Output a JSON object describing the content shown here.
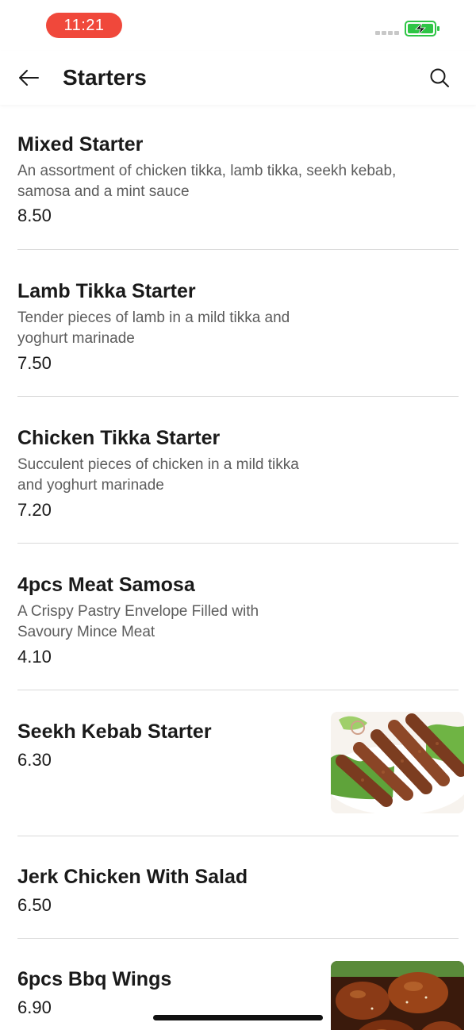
{
  "status_bar": {
    "time": "11:21",
    "time_pill_color": "#f0483b",
    "battery_color": "#2ec545",
    "battery_state": "charging"
  },
  "header": {
    "back_icon": "arrow-left-icon",
    "title": "Starters",
    "search_icon": "search-icon"
  },
  "items": [
    {
      "name": "Mixed Starter",
      "description": "An assortment of chicken tikka, lamb tikka, seekh kebab, samosa and a mint sauce",
      "price": "8.50",
      "has_image": false
    },
    {
      "name": "Lamb Tikka Starter",
      "description": "Tender pieces of lamb in a mild tikka and yoghurt marinade",
      "price": "7.50",
      "has_image": false
    },
    {
      "name": "Chicken Tikka Starter",
      "description": "Succulent pieces of chicken in a mild tikka and yoghurt marinade",
      "price": "7.20",
      "has_image": false
    },
    {
      "name": "4pcs Meat Samosa",
      "description": "A Crispy Pastry Envelope Filled with Savoury Mince Meat",
      "price": "4.10",
      "has_image": false
    },
    {
      "name": "Seekh Kebab Starter",
      "description": "",
      "price": "6.30",
      "has_image": true,
      "image": "seekh-kebab-photo"
    },
    {
      "name": "Jerk Chicken With Salad",
      "description": "",
      "price": "6.50",
      "has_image": false
    },
    {
      "name": "6pcs Bbq Wings",
      "description": "",
      "price": "6.90",
      "has_image": true,
      "image": "bbq-wings-photo"
    }
  ]
}
